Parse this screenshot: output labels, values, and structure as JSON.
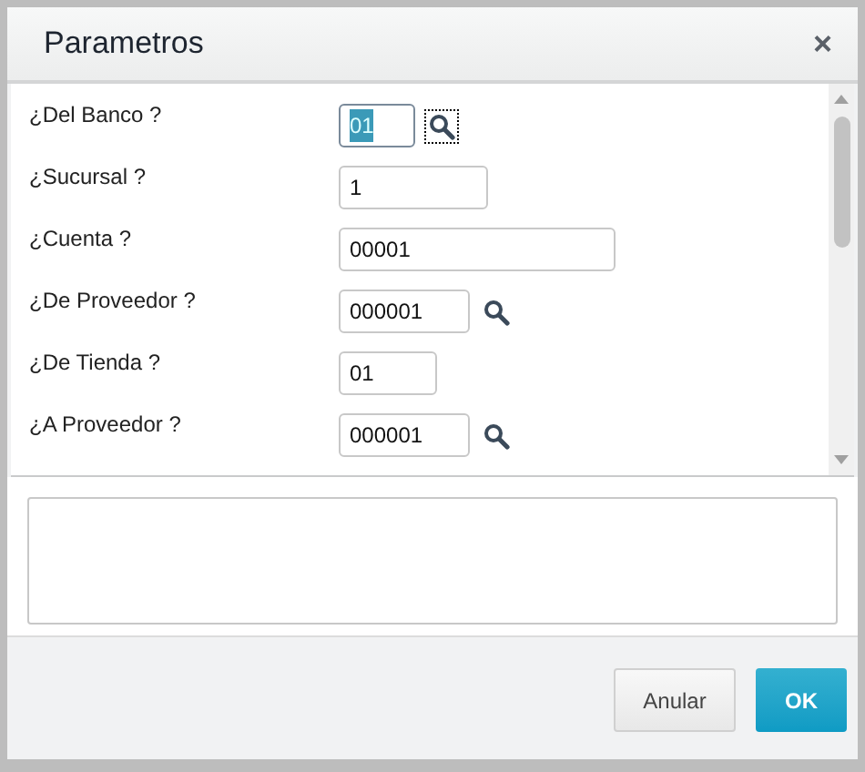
{
  "dialog": {
    "title": "Parametros",
    "close": "×"
  },
  "fields": [
    {
      "label": "¿Del Banco ?",
      "value": "01",
      "lookup": true,
      "focused": true
    },
    {
      "label": "¿Sucursal ?",
      "value": "1",
      "lookup": false,
      "focused": false
    },
    {
      "label": "¿Cuenta ?",
      "value": "00001",
      "lookup": false,
      "focused": false
    },
    {
      "label": "¿De Proveedor ?",
      "value": "000001",
      "lookup": true,
      "focused": false
    },
    {
      "label": "¿De Tienda ?",
      "value": "01",
      "lookup": false,
      "focused": false
    },
    {
      "label": "¿A Proveedor ?",
      "value": "000001",
      "lookup": true,
      "focused": false
    }
  ],
  "buttons": [
    {
      "label": "Anular",
      "kind": "secondary"
    },
    {
      "label": "OK",
      "kind": "primary"
    }
  ]
}
